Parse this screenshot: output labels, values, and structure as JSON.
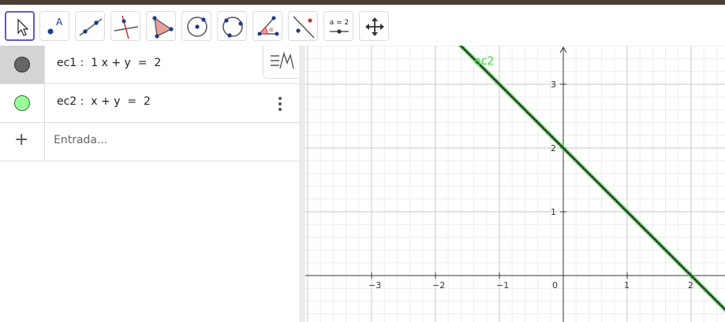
{
  "toolbar": {
    "tools": [
      {
        "name": "move-tool",
        "active": true
      },
      {
        "name": "point-tool",
        "label": "A"
      },
      {
        "name": "line-tool"
      },
      {
        "name": "perpendicular-line-tool"
      },
      {
        "name": "polygon-tool"
      },
      {
        "name": "circle-center-point-tool"
      },
      {
        "name": "circle-three-points-tool"
      },
      {
        "name": "angle-tool"
      },
      {
        "name": "reflect-about-line-tool"
      },
      {
        "name": "slider-tool",
        "label": "a = 2"
      },
      {
        "name": "move-graphics-view-tool"
      }
    ]
  },
  "algebra": {
    "rows": [
      {
        "name": "ec1",
        "expression": "ec1 :  1 x + y  =  2",
        "color": "#666666",
        "selected": true
      },
      {
        "name": "ec2",
        "expression": "ec2 :  x + y  =  2",
        "color": "#99ff99",
        "selected": false
      }
    ],
    "input_placeholder": "Entrada..."
  },
  "graphics": {
    "x_ticks": [
      "−3",
      "−2",
      "−1",
      "0",
      "1",
      "2"
    ],
    "y_ticks": [
      "1",
      "2",
      "3"
    ],
    "line_label": "ec2",
    "line_color": "#2e6b2e",
    "line_highlight": "#66cc66",
    "label_color": "#33dd33"
  }
}
